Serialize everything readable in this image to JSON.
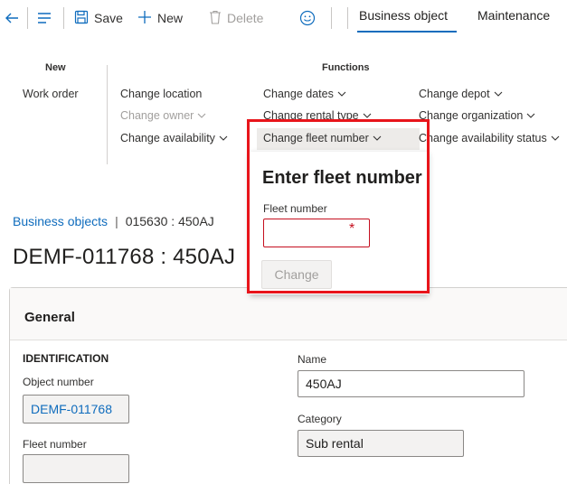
{
  "toolbar": {
    "save_label": "Save",
    "new_label": "New",
    "delete_label": "Delete",
    "tabs": [
      {
        "label": "Business object",
        "active": true
      },
      {
        "label": "Maintenance",
        "active": false
      }
    ],
    "icons": [
      "back-arrow-icon",
      "hamburger-icon",
      "save-icon",
      "plus-icon",
      "delete-icon",
      "smiley-icon"
    ]
  },
  "ribbon": {
    "groups": {
      "new": "New",
      "functions": "Functions"
    },
    "new_items": [
      "Work order"
    ],
    "functions": {
      "col1": [
        "Change location",
        "Change owner",
        "Change availability"
      ],
      "col2": [
        "Change dates",
        "Change rental type",
        "Change fleet number"
      ],
      "col3": [
        "Change depot",
        "Change organization",
        "Change availability status"
      ]
    }
  },
  "breadcrumb": {
    "link": "Business objects",
    "separator": "|",
    "current": "015630 : 450AJ"
  },
  "page": {
    "title": "DEMF-011768 : 450AJ"
  },
  "flyout": {
    "title": "Enter fleet number",
    "field_label": "Fleet number",
    "field_value": "",
    "required_marker": "*",
    "button_label": "Change"
  },
  "card": {
    "title": "General",
    "section": "IDENTIFICATION",
    "fields": {
      "object_number_label": "Object number",
      "object_number_value": "DEMF-011768",
      "fleet_number_label": "Fleet number",
      "fleet_number_value": "",
      "name_label": "Name",
      "name_value": "450AJ",
      "category_label": "Category",
      "category_value": "Sub rental"
    }
  },
  "colors": {
    "accent": "#0f6cbd",
    "highlight": "#e8151b",
    "required": "#c50f1f",
    "disabled": "#a19f9d"
  }
}
